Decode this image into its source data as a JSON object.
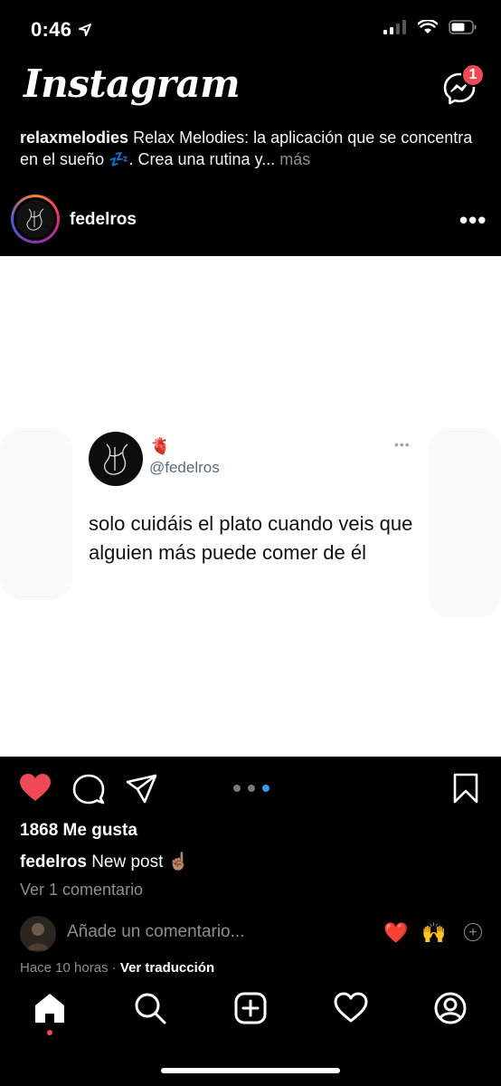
{
  "status_bar": {
    "time": "0:46"
  },
  "header": {
    "logo": "Instagram",
    "messenger_badge": "1"
  },
  "previous_post_caption": {
    "username": "relaxmelodies",
    "text": "Relax Melodies: la aplicación que se concentra en el sueño 💤. Crea una rutina y...",
    "more": "más"
  },
  "post": {
    "username": "fedelros",
    "tweet": {
      "heart_emoji": "🫀",
      "handle": "@fedelros",
      "text": "solo cuidáis el plato cuando veis que alguien más puede comer de él"
    },
    "likes": "1868 Me gusta",
    "caption_username": "fedelros",
    "caption_text": "New post ☝🏽",
    "view_comments": "Ver 1 comentario",
    "comment_placeholder": "Añade un comentario...",
    "quick_emojis": [
      "❤️",
      "🙌"
    ],
    "time": "Hace 10 horas",
    "translate": "Ver traducción",
    "carousel": {
      "count": 3,
      "active_index": 2
    }
  },
  "colors": {
    "background": "#000000",
    "like": "#ed4956",
    "carousel_active": "#3897f0",
    "muted": "#8e8e8e"
  },
  "icons": [
    "signal-icon",
    "wifi-icon",
    "battery-icon",
    "messenger-icon",
    "more-icon",
    "heart-icon",
    "comment-icon",
    "share-icon",
    "bookmark-icon",
    "home-icon",
    "search-icon",
    "new-post-icon",
    "activity-icon",
    "profile-icon"
  ]
}
